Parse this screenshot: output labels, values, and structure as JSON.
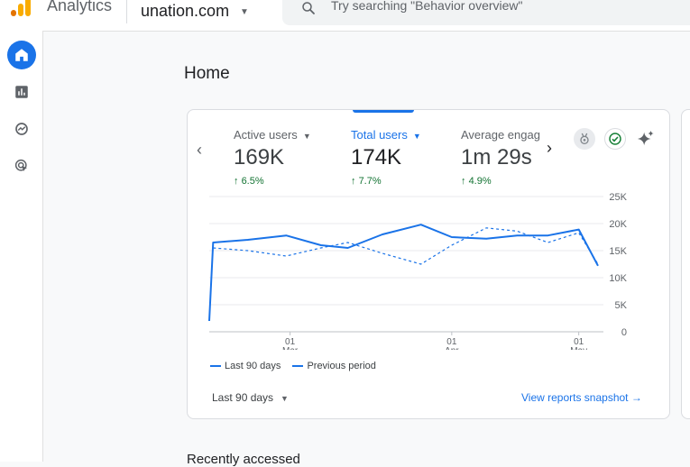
{
  "app": {
    "name": "Analytics",
    "account": "unation.com"
  },
  "search": {
    "placeholder": "Try searching \"Behavior overview\""
  },
  "nav": [
    {
      "name": "home-icon",
      "active": true
    },
    {
      "name": "reports-icon",
      "active": false
    },
    {
      "name": "explore-icon",
      "active": false
    },
    {
      "name": "advertising-icon",
      "active": false
    }
  ],
  "page": {
    "title": "Home"
  },
  "metrics": [
    {
      "label": "Active users",
      "value": "169K",
      "change": "6.5%",
      "selected": false
    },
    {
      "label": "Total users",
      "value": "174K",
      "change": "7.7%",
      "selected": true
    },
    {
      "label": "Average engag",
      "value": "1m 29s",
      "change": "4.9%",
      "selected": false
    }
  ],
  "legend": {
    "current": "Last 90 days",
    "previous": "Previous period"
  },
  "footer": {
    "period": "Last 90 days",
    "link": "View reports snapshot"
  },
  "section": {
    "recent_title": "Recently accessed"
  },
  "colors": {
    "accent": "#1a73e8",
    "positive": "#137333"
  },
  "chart_data": {
    "type": "line",
    "x_tick_labels": [
      {
        "day": "01",
        "month": "Mar"
      },
      {
        "day": "01",
        "month": "Apr"
      },
      {
        "day": "01",
        "month": "May"
      }
    ],
    "y_ticks": [
      "0",
      "5K",
      "10K",
      "15K",
      "20K",
      "25K"
    ],
    "ylim": [
      0,
      25000
    ],
    "grid": true,
    "legend_position": "bottom-left",
    "x_count": 90,
    "series": [
      {
        "name": "Last 90 days",
        "style": "solid",
        "x": [
          0,
          1,
          10,
          20,
          29,
          36,
          45,
          55,
          63,
          72,
          80,
          88,
          96,
          101
        ],
        "y": [
          2000,
          16500,
          17000,
          17800,
          16000,
          15500,
          18000,
          19800,
          17500,
          17200,
          17800,
          17800,
          18900,
          12200
        ]
      },
      {
        "name": "Previous period",
        "style": "dashed",
        "x": [
          1,
          10,
          20,
          29,
          36,
          45,
          55,
          63,
          72,
          80,
          88,
          96,
          101
        ],
        "y": [
          15500,
          15000,
          14000,
          15500,
          16500,
          14500,
          12500,
          16000,
          19200,
          18600,
          16500,
          18300,
          12500
        ]
      }
    ]
  }
}
